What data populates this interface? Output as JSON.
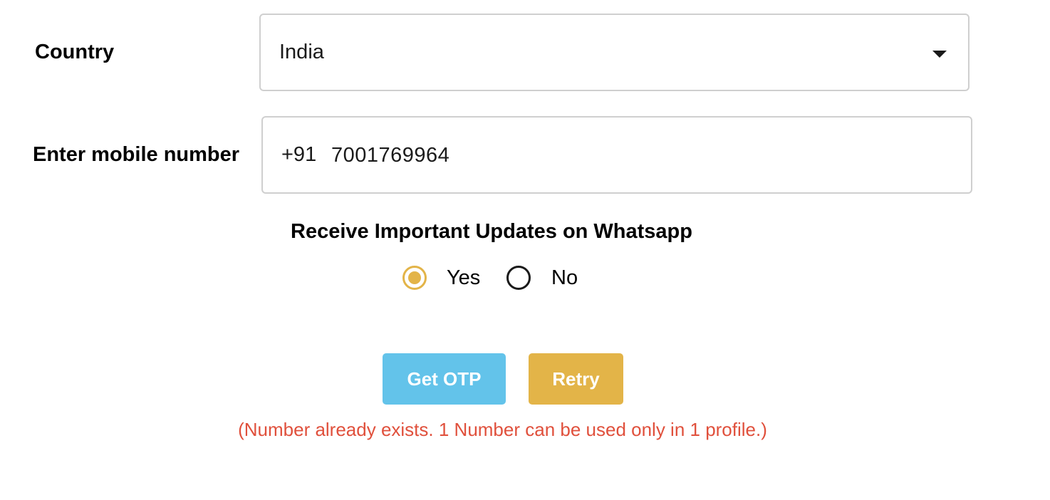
{
  "country": {
    "label": "Country",
    "selected": "India"
  },
  "mobile": {
    "label": "Enter mobile number",
    "code": "+91",
    "value": "7001769964"
  },
  "whatsapp": {
    "title": "Receive Important Updates on Whatsapp",
    "options": [
      {
        "label": "Yes",
        "checked": true
      },
      {
        "label": "No",
        "checked": false
      }
    ]
  },
  "buttons": {
    "get_otp": "Get OTP",
    "retry": "Retry"
  },
  "error": "(Number already exists. 1 Number can be used only in 1 profile.)",
  "colors": {
    "accent": "#e3b448",
    "otp_button": "#63c3ea",
    "error_text": "#e0503c",
    "input_border": "#cfcfcf"
  }
}
